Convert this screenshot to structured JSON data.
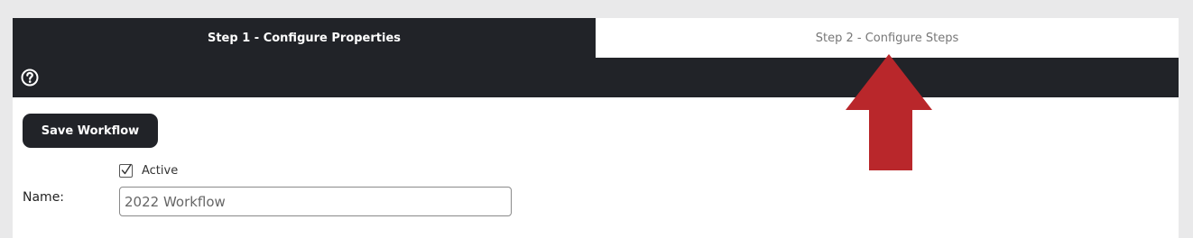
{
  "tabs": [
    {
      "label": "Step 1 - Configure Properties",
      "active": true
    },
    {
      "label": "Step 2 - Configure Steps",
      "active": false
    }
  ],
  "toolbar": {
    "help_icon": "question-circle-icon"
  },
  "form": {
    "save_label": "Save Workflow",
    "active_label": "Active",
    "active_checked": true,
    "name_label": "Name:",
    "name_value": "2022 Workflow"
  },
  "annotation": {
    "icon": "arrow-up-icon",
    "color": "#b9272b"
  },
  "colors": {
    "dark": "#212328",
    "page_bg": "#e9e9ea"
  }
}
